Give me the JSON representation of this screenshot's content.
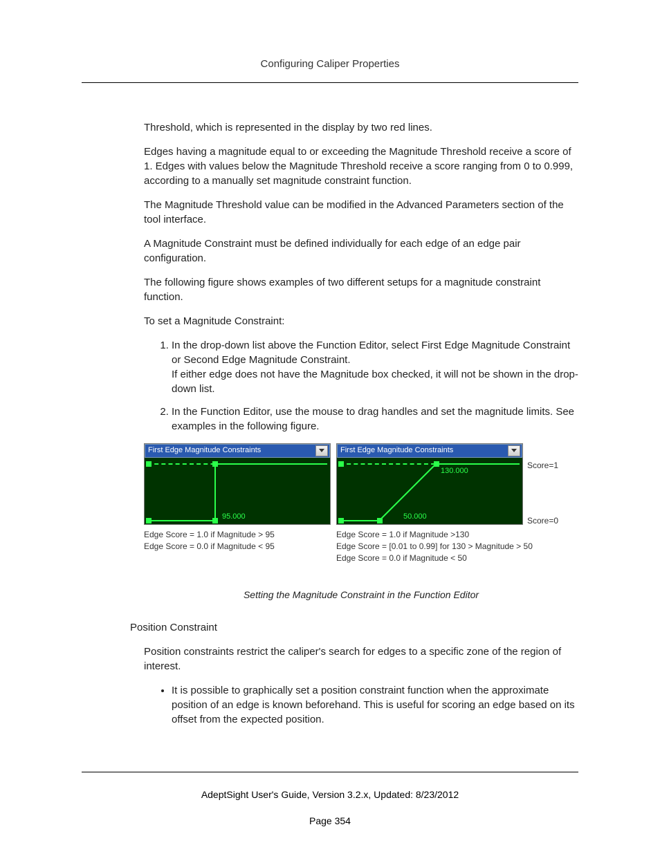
{
  "header": {
    "title": "Configuring Caliper Properties"
  },
  "body": {
    "p1": "Threshold, which is represented in the display by two red lines.",
    "p2": "Edges having a magnitude equal to or exceeding the Magnitude Threshold receive a score of 1. Edges with values below the Magnitude Threshold receive a score ranging from 0 to 0.999, according to a manually set magnitude constraint function.",
    "p3": "The Magnitude Threshold value can be modified in the Advanced Parameters section of the tool interface.",
    "p4": "A Magnitude Constraint must be defined individually for each edge of an edge pair configuration.",
    "p5": "The following figure shows examples of two different setups for a magnitude constraint function.",
    "p6": "To set a Magnitude Constraint:",
    "ol": [
      "In the drop-down list above the Function Editor, select First Edge Magnitude Constraint or Second Edge Magnitude Constraint.\nIf either edge does not have the Magnitude box checked, it will not be shown in the drop-down list.",
      "In the Function Editor, use the mouse to drag handles and set the magnitude limits. See examples in the following figure."
    ],
    "figure": {
      "left": {
        "dropdown": "First Edge Magnitude Constraints",
        "value": "95.000",
        "caption1": "Edge Score = 1.0 if Magnitude > 95",
        "caption2": "Edge Score = 0.0 if Magnitude < 95"
      },
      "right": {
        "dropdown": "First Edge Magnitude Constraints",
        "value_top": "130.000",
        "value_bottom": "50.000",
        "caption1": "Edge Score = 1.0 if Magnitude >130",
        "caption2": "Edge Score = [0.01 to 0.99] for 130 > Magnitude > 50",
        "caption3": "Edge Score = 0.0 if Magnitude < 50",
        "score1": "Score=1",
        "score0": "Score=0"
      },
      "caption": "Setting the Magnitude Constraint in the Function Editor"
    },
    "section2_heading": "Position Constraint",
    "p7": "Position constraints restrict the caliper's search for edges to a specific zone of the region of interest.",
    "ul1": "It is possible to graphically set a position constraint function when the approximate position of an edge is known beforehand. This is useful for scoring an edge based on its offset from the expected position."
  },
  "footer": {
    "line": "AdeptSight User's Guide,  Version 3.2.x, Updated: 8/23/2012",
    "page": "Page 354"
  }
}
